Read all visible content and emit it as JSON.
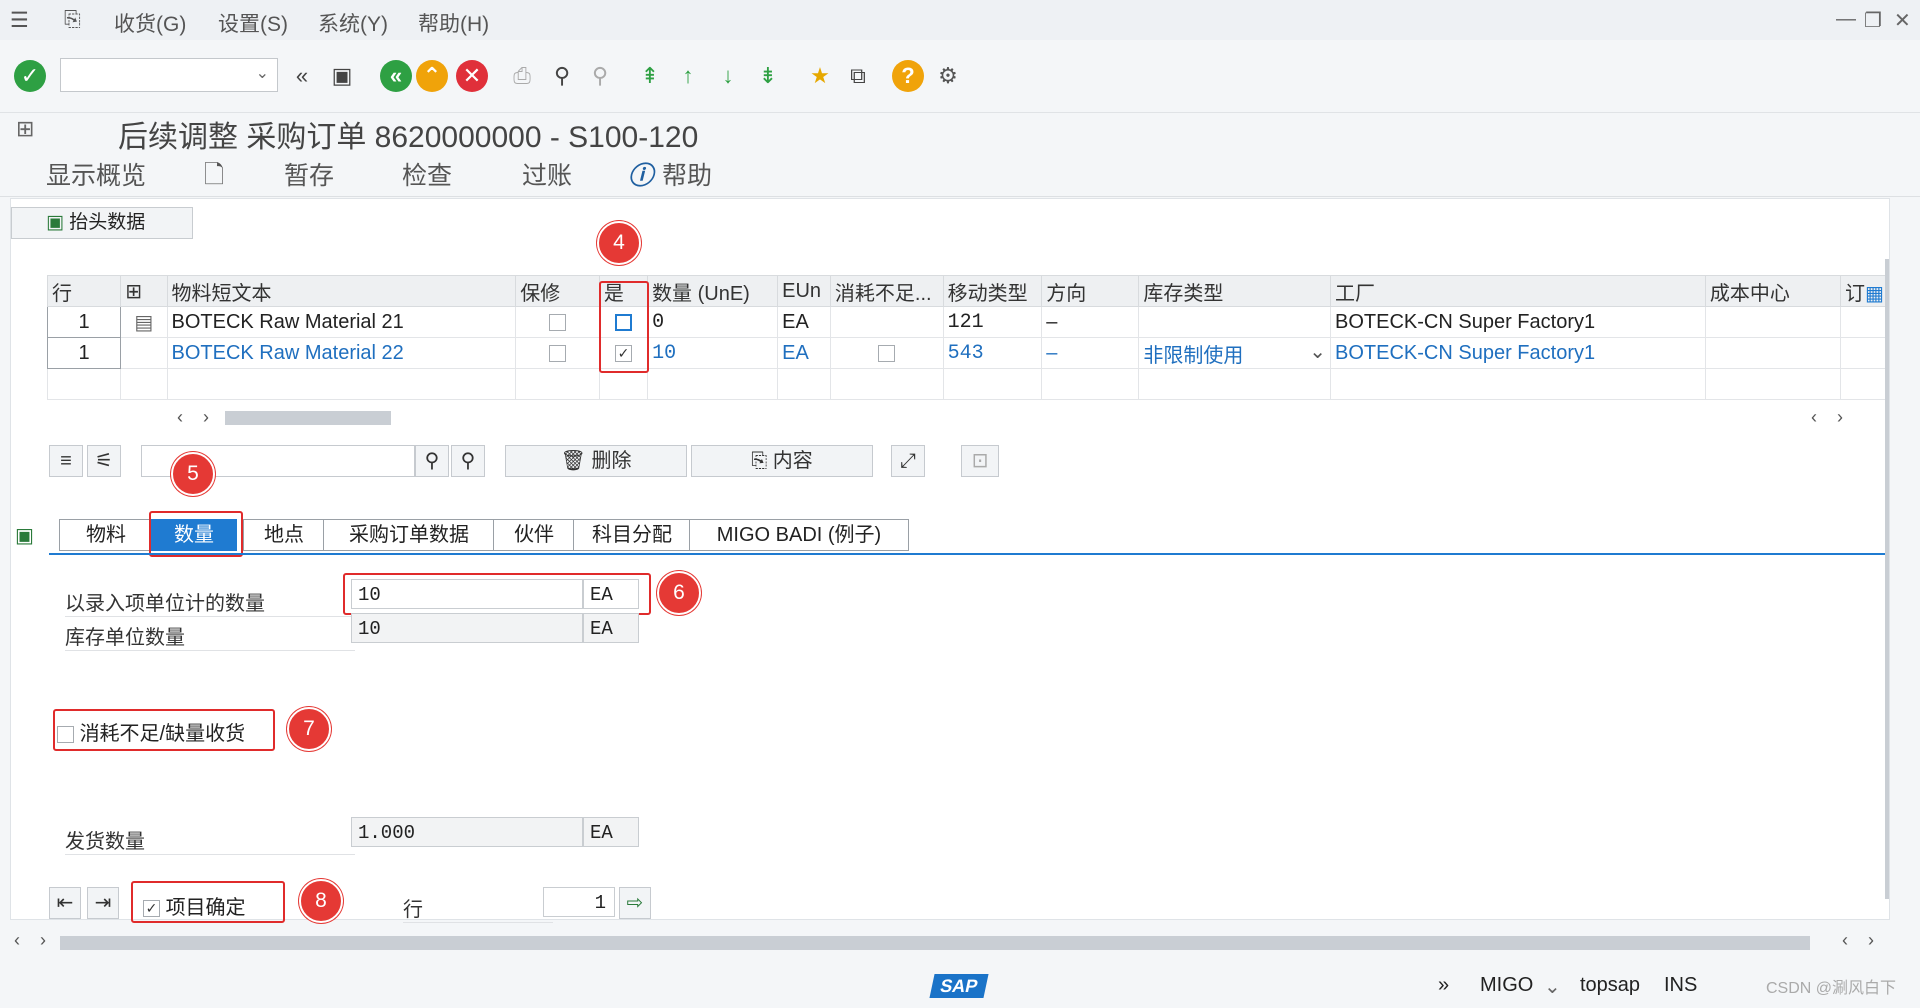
{
  "menu": {
    "items": [
      "收货(G)",
      "设置(S)",
      "系统(Y)",
      "帮助(H)"
    ]
  },
  "title": "后续调整 采购订单 8620000000 - S100-120",
  "app_toolbar": {
    "display_overview": "显示概览",
    "hold": "暂存",
    "check": "检查",
    "post": "过账",
    "help": "帮助"
  },
  "header_button": "抬头数据",
  "grid": {
    "columns": [
      "行",
      "",
      "物料短文本",
      "保修",
      "是",
      "数量 (UnE)",
      "EUn",
      "消耗不足...",
      "移动类型",
      "方向",
      "库存类型",
      "工厂",
      "成本中心",
      "订"
    ],
    "rows": [
      {
        "line": "1",
        "material": "BOTECK Raw Material 21",
        "qty": "0",
        "eun": "EA",
        "movement": "121",
        "direction": "–",
        "stock_type": "",
        "plant": "BOTECK-CN Super Factory1",
        "ok_checked": false
      },
      {
        "line": "1",
        "material": "BOTECK Raw Material 22",
        "qty": "10",
        "eun": "EA",
        "movement": "543",
        "direction": "–",
        "stock_type": "非限制使用",
        "plant": "BOTECK-CN Super Factory1",
        "ok_checked": true
      }
    ]
  },
  "grid_toolbar": {
    "delete": "删除",
    "contents": "内容"
  },
  "tabs": [
    "物料",
    "数量",
    "地点",
    "采购订单数据",
    "伙伴",
    "科目分配",
    "MIGO BADI (例子)"
  ],
  "active_tab": "数量",
  "quantity": {
    "entry_label": "以录入项单位计的数量",
    "entry_value": "10",
    "entry_unit": "EA",
    "stock_label": "库存单位数量",
    "stock_value": "10",
    "stock_unit": "EA",
    "shortfall_label": "消耗不足/缺量收货",
    "delivery_label": "发货数量",
    "delivery_value": "1.000",
    "delivery_unit": "EA"
  },
  "footer": {
    "item_ok_label": "项目确定",
    "line_label": "行",
    "line_value": "1"
  },
  "markers": [
    "4",
    "5",
    "6",
    "7",
    "8"
  ],
  "status": {
    "tcode": "MIGO",
    "server": "topsap",
    "mode": "INS",
    "watermark": "CSDN @涮风白下"
  },
  "colors": {
    "accent_blue": "#1f7bd1",
    "marker_red": "#e53935",
    "ok_green": "#2ea043"
  }
}
